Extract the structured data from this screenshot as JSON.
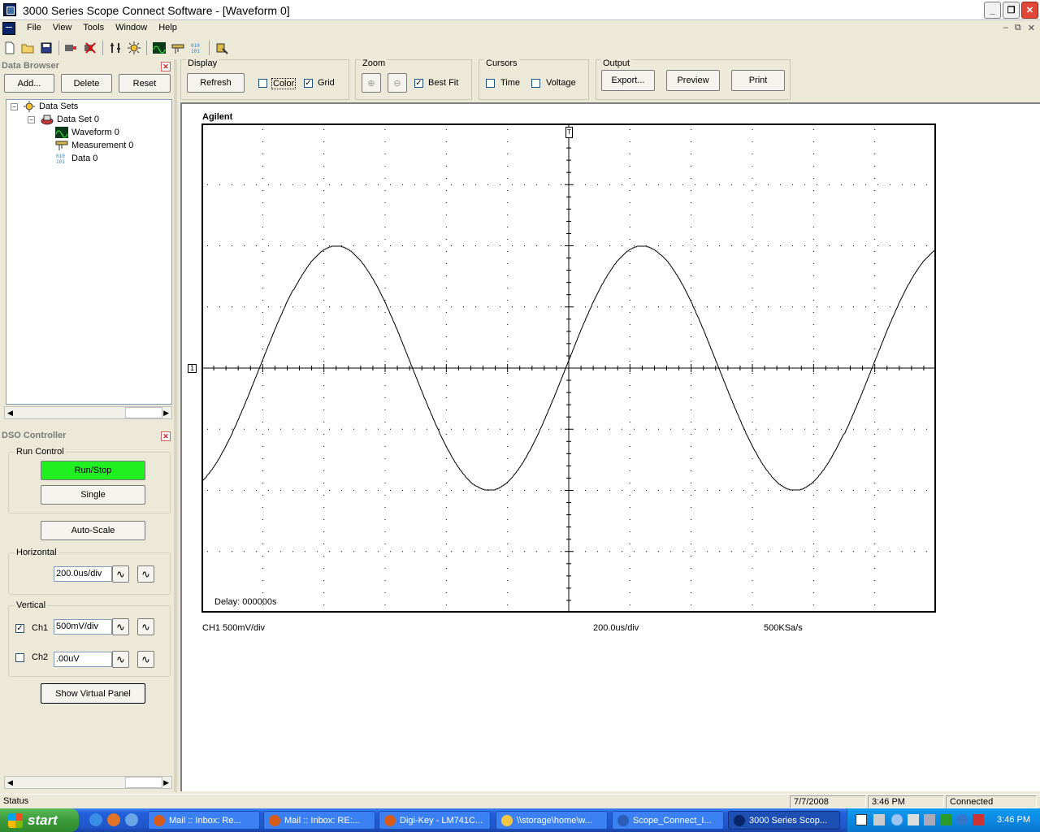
{
  "window": {
    "title": "3000 Series Scope Connect Software - [Waveform 0]",
    "controls": [
      "_",
      "❐",
      "✕"
    ],
    "mdi_controls": [
      "–",
      "⧉",
      "✕"
    ]
  },
  "menu": [
    "File",
    "View",
    "Tools",
    "Window",
    "Help"
  ],
  "data_browser": {
    "title": "Data Browser",
    "buttons": {
      "add": "Add...",
      "delete": "Delete",
      "reset": "Reset"
    },
    "tree": {
      "root": "Data Sets",
      "set": "Data Set 0",
      "items": [
        "Waveform 0",
        "Measurement 0",
        "Data 0"
      ]
    }
  },
  "dso_controller": {
    "title": "DSO Controller",
    "run_control": {
      "label": "Run Control",
      "run_stop": "Run/Stop",
      "single": "Single"
    },
    "auto_scale": "Auto-Scale",
    "horizontal": {
      "label": "Horizontal",
      "value": "200.0us/div"
    },
    "vertical": {
      "label": "Vertical",
      "ch1": {
        "label": "Ch1",
        "value": "500mV/div",
        "checked": true
      },
      "ch2": {
        "label": "Ch2",
        "value": ".00uV",
        "checked": false
      }
    },
    "virtual_panel": "Show Virtual Panel"
  },
  "display_group": {
    "label": "Display",
    "refresh": "Refresh",
    "color": "Color",
    "color_checked": false,
    "grid": "Grid",
    "grid_checked": true
  },
  "zoom_group": {
    "label": "Zoom",
    "best_fit": "Best Fit",
    "best_fit_checked": true
  },
  "cursors_group": {
    "label": "Cursors",
    "time": "Time",
    "voltage": "Voltage"
  },
  "output_group": {
    "label": "Output",
    "export": "Export...",
    "preview": "Preview",
    "print": "Print"
  },
  "plot": {
    "brand": "Agilent",
    "delay": "Delay: 000000s",
    "ch1_scale": "CH1 500mV/div",
    "timebase": "200.0us/div",
    "sample_rate": "500KSa/s",
    "channel_marker": "1",
    "trigger_marker": "T"
  },
  "chart_data": {
    "type": "line",
    "title": "Agilent",
    "x_divisions": 12,
    "y_divisions": 8,
    "time_per_div_us": 200,
    "volts_per_div_mV": 500,
    "xlim_us": [
      -1200,
      1200
    ],
    "ylim_mV": [
      -2000,
      2000
    ],
    "series": [
      {
        "signal": "sine",
        "amplitude_mV": 1000,
        "period_us": 1000,
        "phase_crossing_rising_us": -1010
      }
    ],
    "grid": true
  },
  "status": {
    "left": "Status",
    "date": "7/7/2008",
    "time": "3:46 PM",
    "connection": "Connected"
  },
  "taskbar": {
    "start": "start",
    "tasks": [
      {
        "label": "Mail :: Inbox: Re...",
        "color": "#d95b1a"
      },
      {
        "label": "Mail :: Inbox: RE:...",
        "color": "#d95b1a"
      },
      {
        "label": "Digi-Key - LM741C...",
        "color": "#d95b1a"
      },
      {
        "label": "\\\\storage\\home\\w...",
        "color": "#f3c644"
      },
      {
        "label": "Scope_Connect_I...",
        "color": "#2a5cb8"
      },
      {
        "label": "3000 Series Scop...",
        "color": "#0a246a"
      }
    ],
    "clock": "3:46 PM"
  }
}
